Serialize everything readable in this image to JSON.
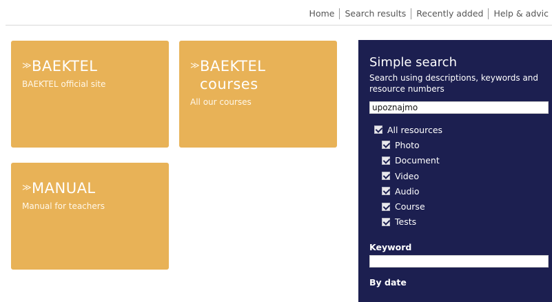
{
  "nav": {
    "items": [
      "Home",
      "Search results",
      "Recently added",
      "Help & advic"
    ]
  },
  "tiles": [
    {
      "title1": "BAEKTEL",
      "title2": "",
      "subtitle": "BAEKTEL official site"
    },
    {
      "title1": "BAEKTEL",
      "title2": "courses",
      "subtitle": "All our courses"
    },
    {
      "title1": "MANUAL",
      "title2": "",
      "subtitle": "Manual for teachers"
    }
  ],
  "search": {
    "title": "Simple search",
    "description": "Search using descriptions, keywords and resource numbers",
    "query_value": "upoznajmo",
    "all_label": "All resources",
    "types": [
      "Photo",
      "Document",
      "Video",
      "Audio",
      "Course",
      "Tests"
    ],
    "keyword_label": "Keyword",
    "keyword_value": "",
    "date_label": "By date"
  },
  "colors": {
    "tile": "#e8b257",
    "panel": "#1c1f50"
  }
}
